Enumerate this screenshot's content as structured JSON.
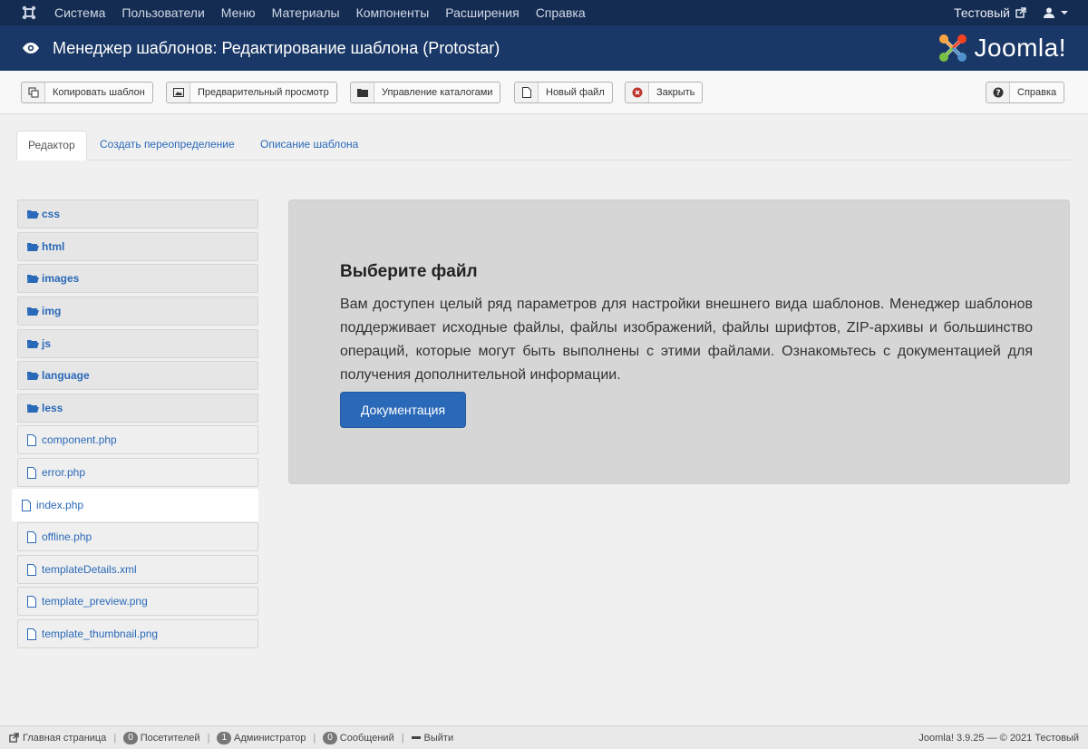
{
  "topnav": {
    "menu": [
      "Система",
      "Пользователи",
      "Меню",
      "Материалы",
      "Компоненты",
      "Расширения",
      "Справка"
    ],
    "site_name": "Тестовый"
  },
  "header": {
    "title": "Менеджер шаблонов: Редактирование шаблона (Protostar)",
    "brand": "Joomla!",
    "brand_word": "Joomla!"
  },
  "toolbar": {
    "copy": "Копировать шаблон",
    "preview": "Предварительный просмотр",
    "manage_folders": "Управление каталогами",
    "new_file": "Новый файл",
    "close": "Закрыть",
    "help": "Справка"
  },
  "tabs": {
    "editor": "Редактор",
    "override": "Создать переопределение",
    "description": "Описание шаблона"
  },
  "tree": {
    "items": [
      {
        "label": "css",
        "type": "folder"
      },
      {
        "label": "html",
        "type": "folder"
      },
      {
        "label": "images",
        "type": "folder"
      },
      {
        "label": "img",
        "type": "folder"
      },
      {
        "label": "js",
        "type": "folder"
      },
      {
        "label": "language",
        "type": "folder"
      },
      {
        "label": "less",
        "type": "folder"
      },
      {
        "label": "component.php",
        "type": "file"
      },
      {
        "label": "error.php",
        "type": "file"
      },
      {
        "label": "index.php",
        "type": "file",
        "selected": true
      },
      {
        "label": "offline.php",
        "type": "file"
      },
      {
        "label": "templateDetails.xml",
        "type": "file"
      },
      {
        "label": "template_preview.png",
        "type": "file"
      },
      {
        "label": "template_thumbnail.png",
        "type": "file"
      }
    ]
  },
  "main": {
    "heading": "Выберите файл",
    "text": "Вам доступен целый ряд параметров для настройки внешнего вида шаблонов. Менеджер шаблонов поддерживает исходные файлы, файлы изображений, файлы шрифтов, ZIP-архивы и большинство операций, которые могут быть выполнены с этими файлами. Ознакомьтесь с документацией для получения дополнительной информации.",
    "doc_button": "Документация"
  },
  "footer": {
    "home": "Главная страница",
    "visitors_count": "0",
    "visitors": "Посетителей",
    "admins_count": "1",
    "admins": "Администратор",
    "messages_count": "0",
    "messages": "Сообщений",
    "logout": "Выйти",
    "version": "Joomla! 3.9.25 — © 2021 Тестовый"
  },
  "colors": {
    "nav_bg": "#152c52",
    "header_bg": "#1a3867",
    "accent": "#2a69b8"
  }
}
